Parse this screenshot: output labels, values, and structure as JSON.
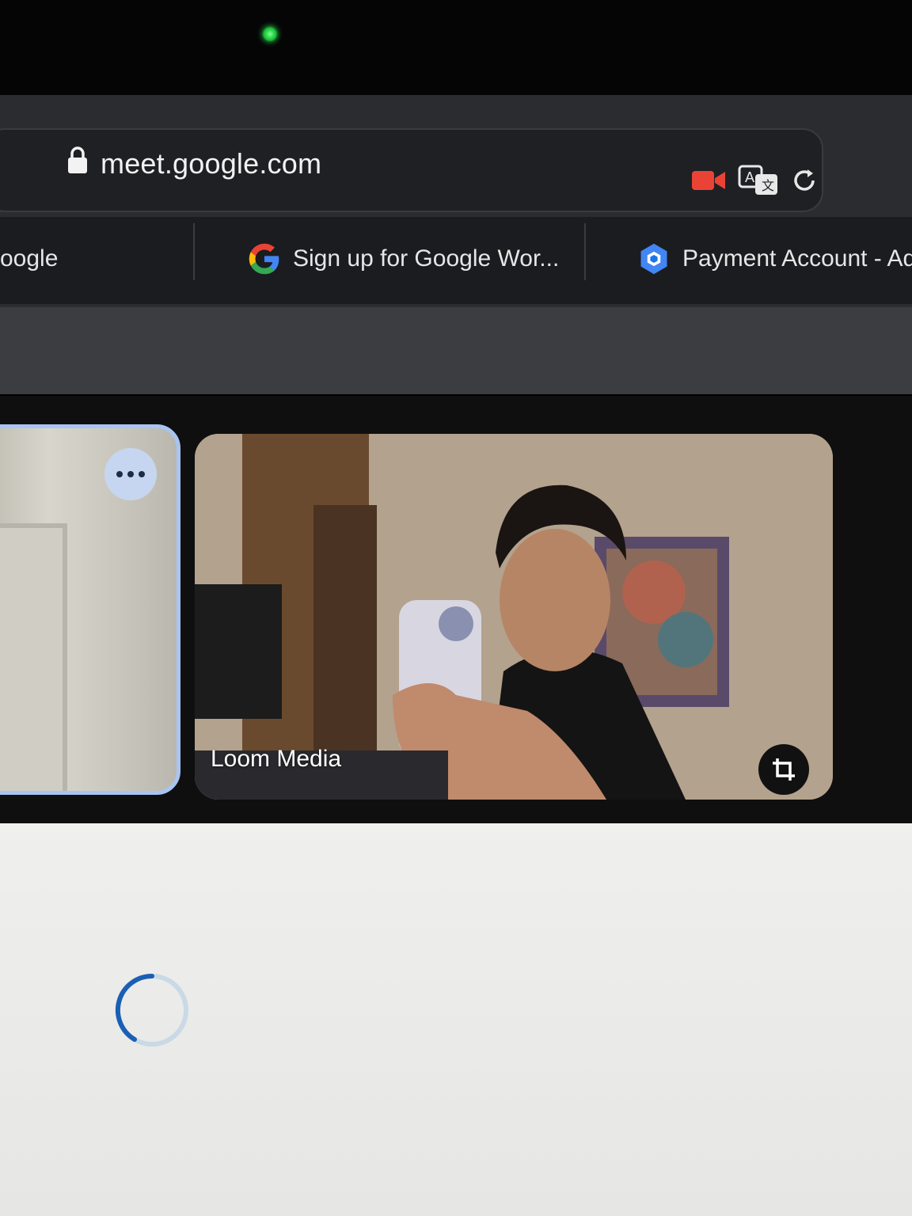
{
  "browser": {
    "url": "meet.google.com",
    "tabs": [
      {
        "label": "oogle",
        "icon": "tab-icon-partial"
      },
      {
        "label": "Sign up for Google Wor...",
        "icon": "google-g-icon"
      },
      {
        "label": "Payment Account - Ad",
        "icon": "cloud-hex-icon"
      }
    ],
    "url_bar_icons": [
      "camera-in-use-icon",
      "translate-icon",
      "reload-icon"
    ]
  },
  "meet": {
    "participants": [
      {
        "name": "",
        "tile": "left-partial",
        "menu_icon": "more-options-icon"
      },
      {
        "name": "Loom Media",
        "tile": "main",
        "action_icon": "frame-crop-icon"
      }
    ]
  },
  "status": {
    "loading_icon": "loading-spinner-icon"
  },
  "colors": {
    "camera_active": "#ea4335",
    "speaking_border": "#a8c4f2",
    "spinner": "#1a5fb4"
  }
}
